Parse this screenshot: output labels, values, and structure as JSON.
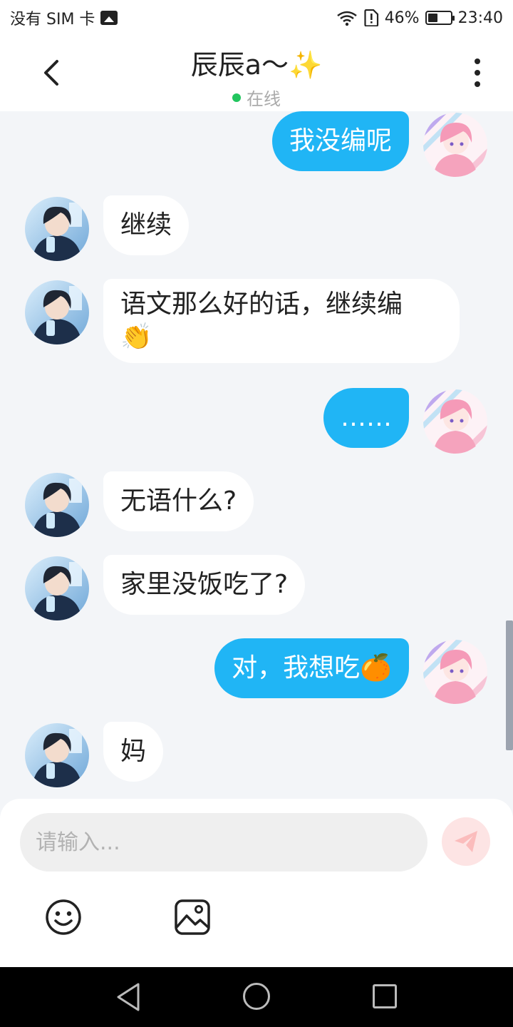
{
  "status_bar": {
    "carrier": "没有 SIM 卡",
    "battery": "46%",
    "battery_level": 0.46,
    "time": "23:40",
    "icons": [
      "image-icon",
      "wifi-icon",
      "alert-icon",
      "battery-icon"
    ]
  },
  "header": {
    "title": "辰辰a～✨",
    "status": "在线",
    "status_color": "#22c55e"
  },
  "messages": [
    {
      "sender": "self",
      "text": "我没编呢"
    },
    {
      "sender": "other",
      "text": "继续"
    },
    {
      "sender": "other",
      "text": "语文那么好的话，继续编\n👏"
    },
    {
      "sender": "self",
      "text": "……"
    },
    {
      "sender": "other",
      "text": "无语什么?"
    },
    {
      "sender": "other",
      "text": "家里没饭吃了?"
    },
    {
      "sender": "self",
      "text": "对，我想吃🍊"
    },
    {
      "sender": "other",
      "text": "妈"
    }
  ],
  "composer": {
    "placeholder": "请输入...",
    "value": ""
  },
  "colors": {
    "accent": "#20b5f5",
    "background": "#f3f5f8",
    "send_button": "#fde4e4"
  }
}
